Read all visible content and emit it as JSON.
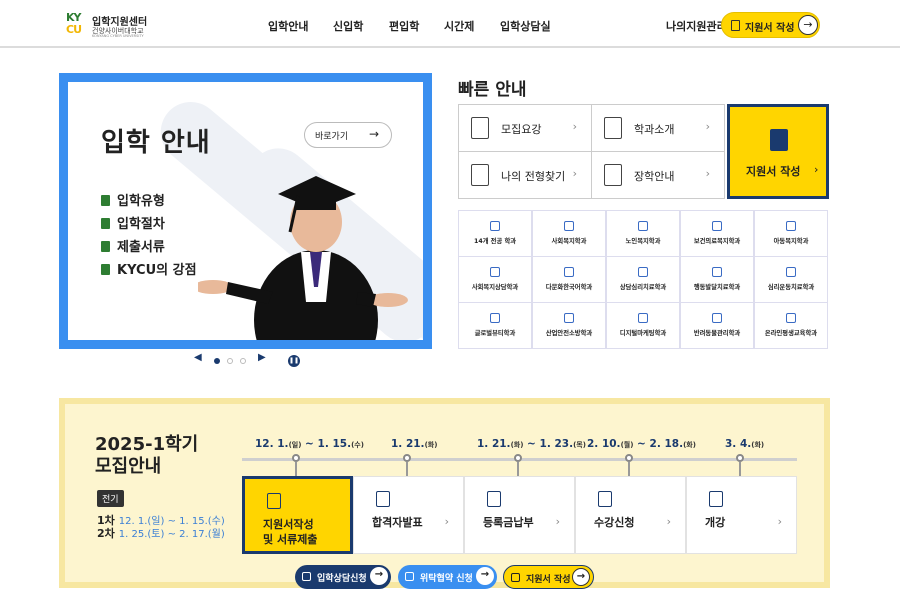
{
  "header": {
    "logo_mark_top": "KY",
    "logo_mark_bottom": "CU",
    "logo_title": "입학지원센터",
    "logo_subtitle": "건양사이버대학교",
    "logo_en": "KONYANG CYBER UNIVERSITY",
    "nav": [
      "입학안내",
      "신입학",
      "편입학",
      "시간제",
      "입학상담실"
    ],
    "my_application": "나의지원관리",
    "apply_button": "지원서 작성"
  },
  "banner": {
    "title": "입학 안내",
    "goto_label": "바로가기",
    "items": [
      "입학유형",
      "입학절차",
      "제출서류",
      "KYCU의 강점"
    ]
  },
  "quick": {
    "title": "빠른 안내",
    "boxes": [
      "모집요강",
      "학과소개",
      "나의 전형찾기",
      "장학안내"
    ],
    "apply": "지원서 작성"
  },
  "departments": [
    "14개 전공 학과",
    "사회복지학과",
    "노인복지학과",
    "보건의료복지학과",
    "아동복지학과",
    "사회복지상담학과",
    "다문화한국어학과",
    "상담심리치료학과",
    "행동발달치료학과",
    "심리운동치료학과",
    "글로벌뷰티학과",
    "산업안전소방학과",
    "디지털마케팅학과",
    "반려동물관리학과",
    "온라인평생교육학과"
  ],
  "schedule": {
    "title_line1": "2025-1학기",
    "title_line2": "모집안내",
    "tag": "전기",
    "round1_label": "1차",
    "round1_dates": "12. 1.(일) ~ 1. 15.(수)",
    "round2_label": "2차",
    "round2_dates": "1. 25.(토) ~ 2. 17.(월)",
    "dates": [
      {
        "main": "12. 1.",
        "day": "(일)",
        "main2": " ~ 1. 15.",
        "day2": "(수)"
      },
      {
        "main": "1. 21.",
        "day": "(화)",
        "main2": "",
        "day2": ""
      },
      {
        "main": "1. 21.",
        "day": "(화)",
        "main2": " ~ 1. 23.",
        "day2": "(목)"
      },
      {
        "main": "2. 10.",
        "day": "(월)",
        "main2": " ~ 2. 18.",
        "day2": "(화)"
      },
      {
        "main": "3. 4.",
        "day": "(화)",
        "main2": "",
        "day2": ""
      }
    ],
    "steps": [
      {
        "line1": "지원서작성",
        "line2": "및 서류제출"
      },
      {
        "line1": "합격자발표",
        "line2": ""
      },
      {
        "line1": "등록금납부",
        "line2": ""
      },
      {
        "line1": "수강신청",
        "line2": ""
      },
      {
        "line1": "개강",
        "line2": ""
      }
    ]
  },
  "bottom_buttons": [
    "입학상담신청",
    "위탁협약 신청",
    "지원서 작성"
  ],
  "colors": {
    "navy": "#1a3a6e",
    "yellow": "#ffd500",
    "blue": "#3a8ff0",
    "green": "#2e7d32"
  }
}
